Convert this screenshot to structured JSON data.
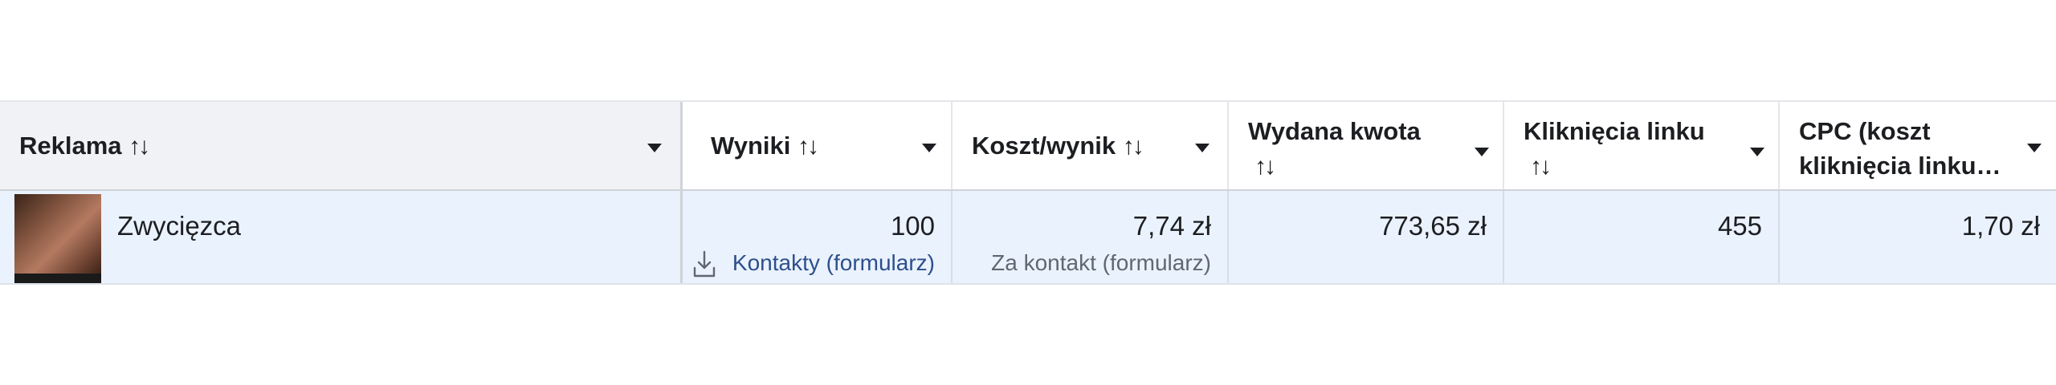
{
  "columns": [
    {
      "label": "Reklama",
      "label2": ""
    },
    {
      "label": "Wyniki",
      "label2": ""
    },
    {
      "label": "Koszt/wynik",
      "label2": ""
    },
    {
      "label": "Wydana kwota",
      "label2": ""
    },
    {
      "label": "Kliknięcia linku",
      "label2": ""
    },
    {
      "label": "CPC (koszt",
      "label2": "kliknięcia linku…"
    }
  ],
  "sort_icon": "↑↓",
  "row": {
    "thumbnail_icon": "ad-thumbnail-image",
    "ad_name": "Zwycięzca",
    "results": "100",
    "results_type": "Kontakty (formularz)",
    "results_type_icon": "download-icon",
    "cost_per_result": "7,74 zł",
    "cost_per_result_note": "Za kontakt (formularz)",
    "amount_spent": "773,65 zł",
    "link_clicks": "455",
    "cpc": "1,70 zł"
  }
}
